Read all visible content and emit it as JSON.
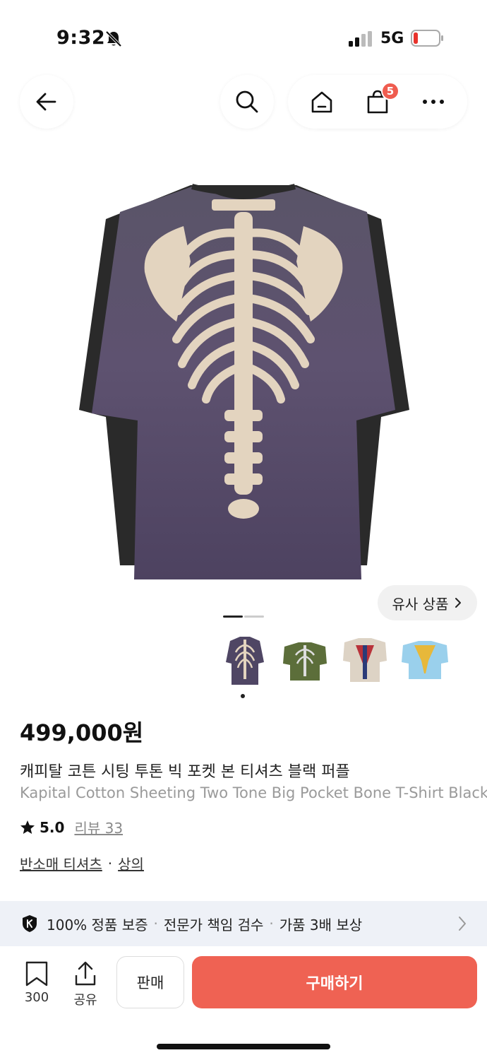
{
  "status_bar": {
    "time": "9:32",
    "network": "5G"
  },
  "header": {
    "cart_count": "5"
  },
  "gallery": {
    "similar_label": "유사 상품",
    "current_page": 1,
    "total_pages": 2,
    "thumbnails": [
      "purple-bone-tee",
      "olive-bone-tee",
      "flag-bone-tee",
      "blue-bone-tee"
    ]
  },
  "product": {
    "price": "499,000원",
    "title_ko": "캐피탈 코튼 시팅 투톤 빅 포켓 본 티셔츠 블랙 퍼플",
    "title_en": "Kapital Cotton Sheeting Two Tone Big Pocket Bone T-Shirt Black Purple",
    "rating": "5.0",
    "reviews_label": "리뷰 33",
    "category_1": "반소매 티셔츠",
    "separator": "·",
    "category_2": "상의"
  },
  "guarantee": {
    "item_1": "100% 정품 보증",
    "item_2": "전문가 책임 검수",
    "item_3": "가품 3배 보상"
  },
  "bottom_bar": {
    "bookmark_count": "300",
    "share_label": "공유",
    "sell_label": "판매",
    "buy_label": "구매하기"
  },
  "colors": {
    "accent": "#ef6253",
    "badge": "#ef5c4f",
    "guarantee_bg": "#eef1f7"
  }
}
